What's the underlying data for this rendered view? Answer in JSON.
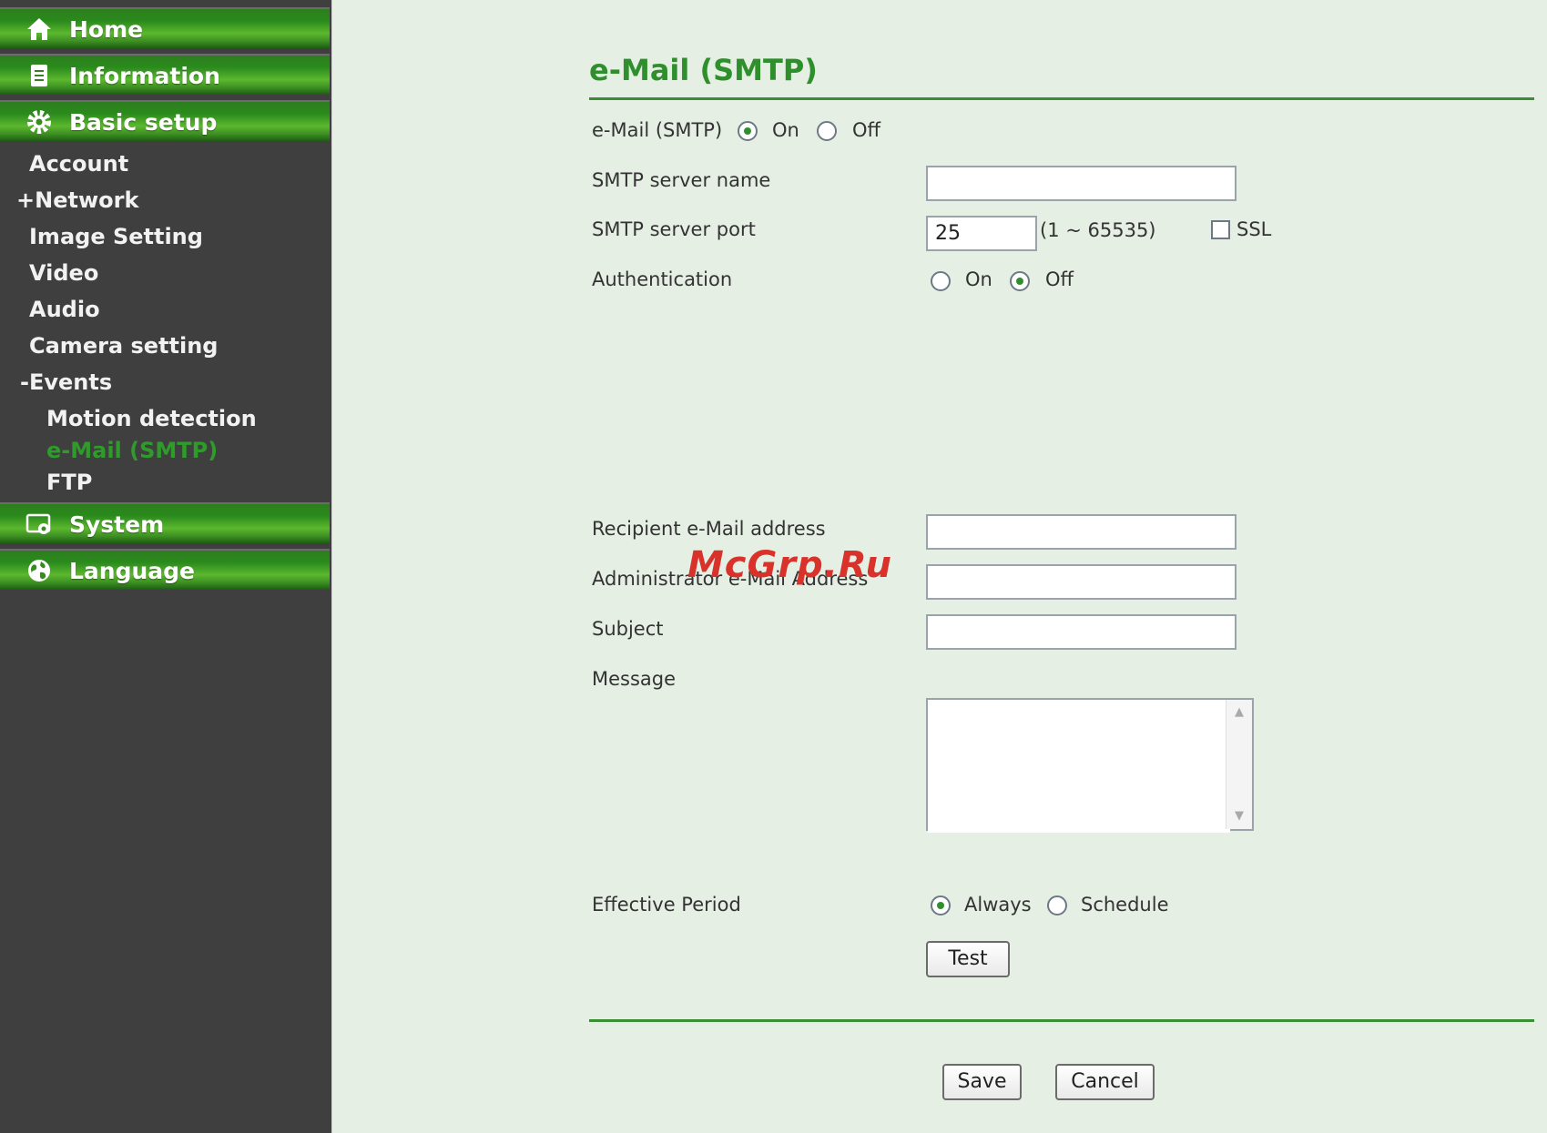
{
  "sidebar": {
    "home": "Home",
    "information": "Information",
    "basic_setup": "Basic setup",
    "items": [
      "Account",
      "+Network",
      "Image Setting",
      "Video",
      "Audio",
      "Camera setting",
      "-Events"
    ],
    "events_items": [
      "Motion detection",
      "e-Mail (SMTP)",
      "FTP"
    ],
    "system": "System",
    "language": "Language"
  },
  "page": {
    "title": "e-Mail (SMTP)",
    "email_smtp_label": "e-Mail (SMTP)",
    "on": "On",
    "off": "Off",
    "smtp_server_name_label": "SMTP server name",
    "smtp_server_name_value": "",
    "smtp_server_port_label": "SMTP server port",
    "smtp_server_port_value": "25",
    "port_range": "(1 ~ 65535)",
    "ssl_label": "SSL",
    "authentication_label": "Authentication",
    "recipient_label": "Recipient e-Mail address",
    "admin_label": "Administrator e-Mail Address",
    "subject_label": "Subject",
    "message_label": "Message",
    "effective_period_label": "Effective Period",
    "always": "Always",
    "schedule": "Schedule",
    "test_button": "Test",
    "save_button": "Save",
    "cancel_button": "Cancel"
  },
  "state": {
    "email_smtp": "On",
    "authentication": "Off",
    "effective_period": "Always",
    "ssl_checked": false
  },
  "watermark": "McGrp.Ru",
  "colors": {
    "accent": "#2f8f2c",
    "sidebar_bg": "#3f3f3f",
    "page_bg": "#e6efe4"
  }
}
